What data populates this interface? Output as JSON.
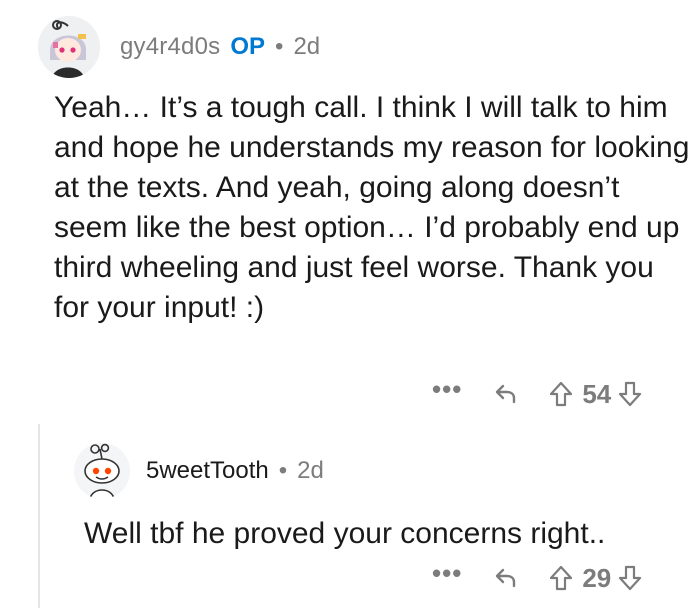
{
  "comments": [
    {
      "author": "gy4r4d0s",
      "op_badge": "OP",
      "separator": "•",
      "age": "2d",
      "body": "Yeah… It’s a tough call. I think I will talk to him and hope he understands my reason for looking at the texts. And yeah, going along doesn’t seem like the best option… I’d probably end up third wheeling and just feel worse. Thank you for your input! :)",
      "more_label": "•••",
      "score": "54"
    },
    {
      "author": "5weetTooth",
      "separator": "•",
      "age": "2d",
      "body": "Well tbf he proved your concerns right..",
      "more_label": "•••",
      "score": "29"
    }
  ],
  "colors": {
    "op_accent": "#0079d3",
    "meta_text": "#7c7c7c",
    "body_text": "#1a1a1b",
    "thread_line": "#e5e5e5"
  },
  "icons": [
    "more-icon",
    "reply-icon",
    "upvote-icon",
    "downvote-icon"
  ]
}
